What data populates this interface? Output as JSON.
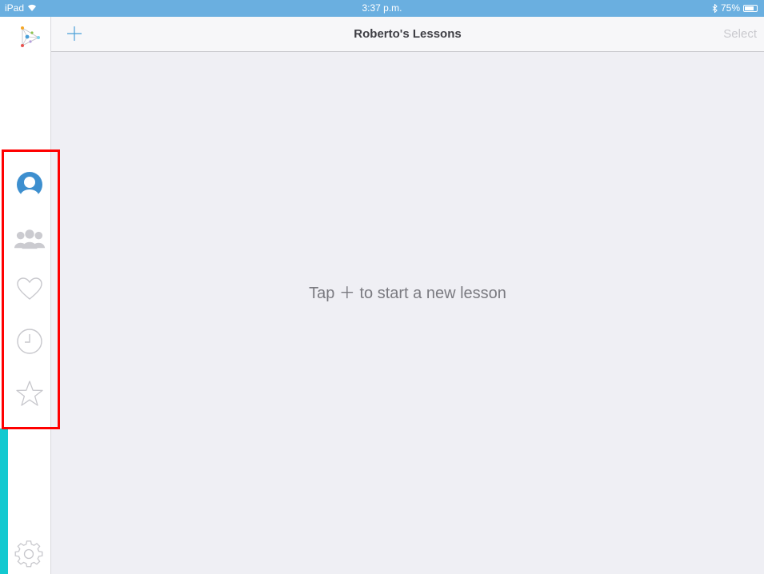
{
  "status_bar": {
    "carrier": "iPad",
    "time": "3:37 p.m.",
    "battery_percent": "75%",
    "battery_level": 0.75
  },
  "sidebar": {
    "items": [
      {
        "name": "profile",
        "icon": "person-icon",
        "active": true
      },
      {
        "name": "groups",
        "icon": "people-icon",
        "active": false
      },
      {
        "name": "favorites",
        "icon": "heart-icon",
        "active": false
      },
      {
        "name": "recent",
        "icon": "clock-icon",
        "active": false
      },
      {
        "name": "starred",
        "icon": "star-icon",
        "active": false
      }
    ],
    "settings_icon": "gear-icon"
  },
  "nav": {
    "add_icon": "plus-icon",
    "title": "Roberto's Lessons",
    "select_label": "Select"
  },
  "main": {
    "empty_message": "Tap ＋ to start a new lesson"
  },
  "colors": {
    "status_bar": "#6aafe0",
    "accent": "#4a9fd8",
    "highlight": "#ff0000",
    "teal": "#12c9d0"
  }
}
